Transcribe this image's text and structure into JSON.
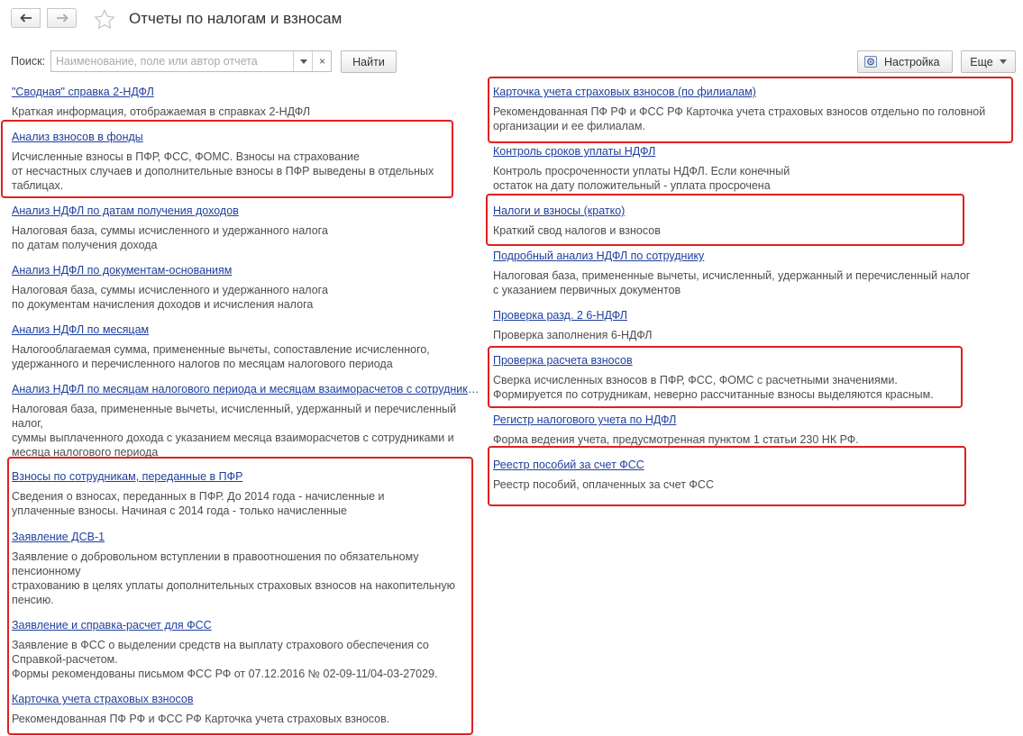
{
  "header": {
    "title": "Отчеты по налогам и взносам",
    "back_icon": "arrow-left-icon",
    "forward_icon": "arrow-right-icon",
    "favorite_icon": "star-icon"
  },
  "search": {
    "label": "Поиск:",
    "placeholder": "Наименование, поле или автор отчета",
    "value": "",
    "clear_label": "×",
    "find_label": "Найти"
  },
  "toolbar": {
    "settings_label": "Настройка",
    "more_label": "Еще"
  },
  "left_items": [
    {
      "title": "\"Сводная\" справка 2-НДФЛ",
      "desc": "Краткая информация, отображаемая в справках 2-НДФЛ"
    },
    {
      "title": "Анализ взносов в фонды",
      "desc": "Исчисленные взносы в ПФР, ФСС, ФОМС. Взносы на страхование\nот несчастных случаев и дополнительные взносы в ПФР выведены в отдельных\nтаблицах."
    },
    {
      "title": "Анализ НДФЛ по датам получения доходов",
      "desc": "Налоговая база, суммы исчисленного и удержанного налога\nпо датам получения дохода"
    },
    {
      "title": "Анализ НДФЛ по документам-основаниям",
      "desc": "Налоговая база, суммы исчисленного и удержанного налога\nпо документам начисления доходов и исчисления налога"
    },
    {
      "title": "Анализ НДФЛ по месяцам",
      "desc": "Налогооблагаемая сумма, примененные вычеты, сопоставление исчисленного,\nудержанного и перечисленного налогов по месяцам налогового периода"
    },
    {
      "title": "Анализ НДФЛ по месяцам налогового периода и месяцам взаиморасчетов с сотрудниками",
      "desc": "Налоговая база, примененные вычеты, исчисленный, удержанный и перечисленный\nналог,\nсуммы выплаченного дохода с указанием месяца взаиморасчетов с сотрудниками и\nмесяца налогового периода"
    },
    {
      "title": "Взносы по сотрудникам, переданные в ПФР",
      "desc": "Сведения о взносах, переданных в ПФР. До 2014 года - начисленные и\nуплаченные взносы. Начиная с 2014 года - только начисленные"
    },
    {
      "title": "Заявление ДСВ-1",
      "desc": "Заявление о добровольном вступлении в правоотношения по обязательному\nпенсионному\nстрахованию в целях уплаты дополнительных страховых взносов на накопительную\nпенсию."
    },
    {
      "title": "Заявление и справка-расчет для ФСС",
      "desc": "Заявление в ФСС о выделении средств на выплату страхового обеспечения со\nСправкой-расчетом.\nФормы рекомендованы письмом ФСС РФ от 07.12.2016 № 02-09-11/04-03-27029."
    },
    {
      "title": "Карточка учета страховых взносов",
      "desc": "Рекомендованная ПФ РФ и ФСС РФ Карточка учета страховых взносов."
    }
  ],
  "right_items": [
    {
      "title": "Карточка учета страховых взносов (по филиалам)",
      "desc": "Рекомендованная ПФ РФ и ФСС РФ Карточка учета страховых взносов отдельно по головной\nорганизации и ее филиалам."
    },
    {
      "title": "Контроль сроков уплаты НДФЛ",
      "desc": "Контроль просроченности уплаты НДФЛ. Если конечный\nостаток на дату положительный - уплата просрочена"
    },
    {
      "title": "Налоги и взносы (кратко)",
      "desc": "Краткий свод налогов и взносов"
    },
    {
      "title": "Подробный анализ НДФЛ по сотруднику",
      "desc": "Налоговая база, примененные вычеты, исчисленный, удержанный и перечисленный налог\nс указанием первичных документов"
    },
    {
      "title": "Проверка разд. 2 6-НДФЛ",
      "desc": "Проверка заполнения 6-НДФЛ"
    },
    {
      "title": "Проверка расчета взносов",
      "desc": "Сверка исчисленных взносов в ПФР, ФСС, ФОМС с расчетными значениями.\nФормируется по сотрудникам, неверно рассчитанные взносы выделяются красным."
    },
    {
      "title": "Регистр налогового учета по НДФЛ",
      "desc": "Форма ведения учета, предусмотренная пунктом 1 статьи 230 НК РФ."
    },
    {
      "title": "Реестр пособий за счет ФСС",
      "desc": "Реестр пособий, оплаченных за счет ФСС"
    }
  ],
  "colors": {
    "link": "#1f3f9e",
    "text": "#4d4d4d",
    "highlight_border": "#e02020"
  }
}
